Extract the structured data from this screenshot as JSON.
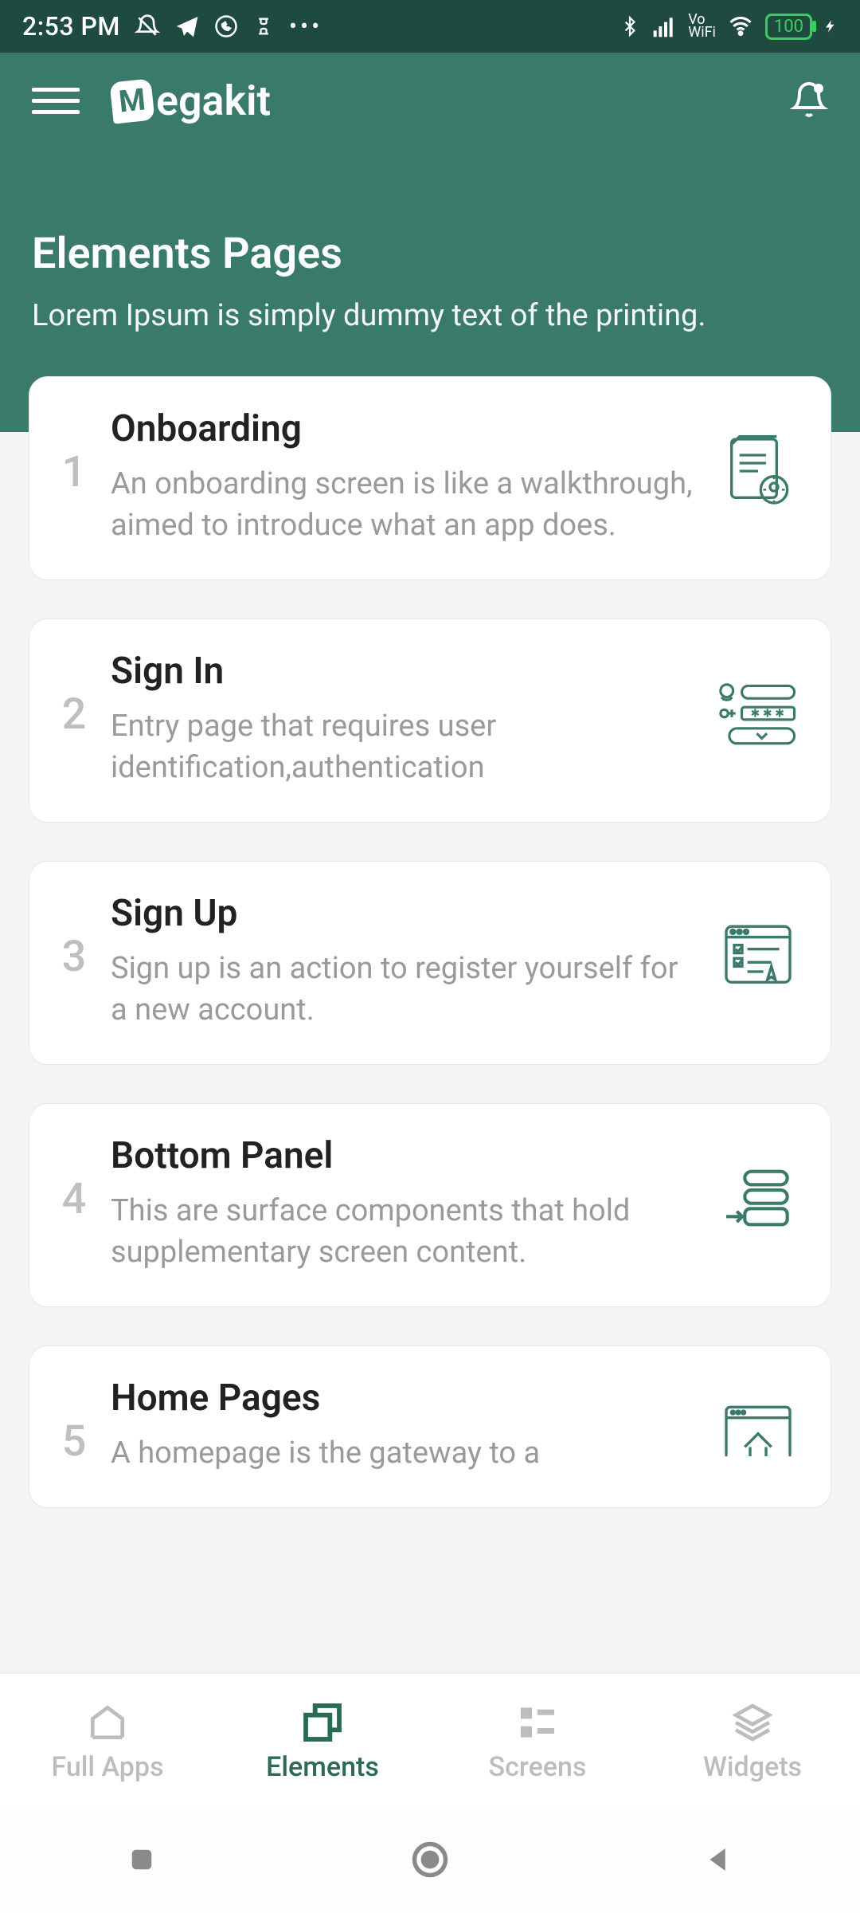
{
  "status": {
    "time": "2:53 PM",
    "battery": "100"
  },
  "app": {
    "brand": "egakit",
    "brand_initial": "M"
  },
  "header": {
    "title": "Elements Pages",
    "subtitle": "Lorem Ipsum is simply dummy text of the printing."
  },
  "items": [
    {
      "num": "1",
      "title": "Onboarding",
      "desc": "An onboarding screen is like a walkthrough, aimed to introduce what an app does."
    },
    {
      "num": "2",
      "title": "Sign In",
      "desc": "Entry page that requires user identification,authentication"
    },
    {
      "num": "3",
      "title": "Sign Up",
      "desc": "Sign up is an action to register yourself for a new account."
    },
    {
      "num": "4",
      "title": "Bottom Panel",
      "desc": "This are surface components that hold supplementary screen content."
    },
    {
      "num": "5",
      "title": "Home Pages",
      "desc": "A homepage is the gateway to a"
    }
  ],
  "tabs": {
    "full_apps": "Full Apps",
    "elements": "Elements",
    "screens": "Screens",
    "widgets": "Widgets"
  }
}
